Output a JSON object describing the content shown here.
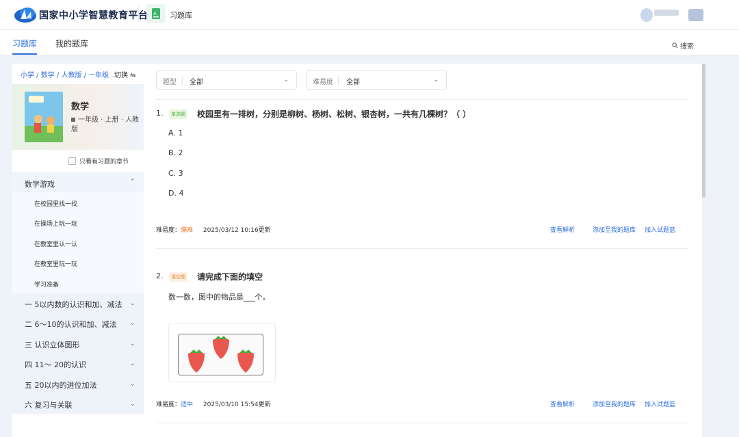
{
  "header": {
    "brand": "国家中小学智慧教育平台",
    "app_name": "习题库"
  },
  "tabs": [
    {
      "label": "习题库",
      "active": true
    },
    {
      "label": "我的题库",
      "active": false
    }
  ],
  "search": {
    "label": "搜索"
  },
  "sidebar": {
    "breadcrumb": "小学 / 数学 / 人教版 / 一年级 ...",
    "switch_label": "切换 ⇋",
    "book": {
      "cover_text": "数学",
      "title": "数学",
      "meta": "一年级 · 上册 · 人教版"
    },
    "only_with_questions": "只看有习题的章节",
    "open_chapter": "数学游戏",
    "sub_items": [
      "在校园里找一找",
      "在操场上玩一玩",
      "在教室里认一认",
      "在教室里玩一玩",
      "学习准备"
    ],
    "chapters": [
      "一  5以内数的认识和加、减法",
      "二  6～10的认识和加、减法",
      "三  认识立体图形",
      "四 11～ 20的认识",
      "五 20以内的进位加法",
      "六 复习与关联"
    ]
  },
  "filters": [
    {
      "key": "题型",
      "value": "全部"
    },
    {
      "key": "难易度",
      "value": "全部"
    }
  ],
  "questions": [
    {
      "num": "1.",
      "tag": "单选题",
      "title": "校园里有一排树，分别是柳树、杨树、松树、银杏树，一共有几棵树？（      ）",
      "options": [
        "A. 1",
        "B. 2",
        "C. 3",
        "D. 4"
      ],
      "difficulty_label": "难易度：",
      "difficulty": "偏难",
      "updated": "2025/03/12 10:16更新"
    },
    {
      "num": "2.",
      "tag": "填空题",
      "title": "请完成下面的填空",
      "body": "数一数，图中的物品是___个。",
      "difficulty_label": "难易度：",
      "difficulty": "适中",
      "updated": "2025/03/10 15:54更新"
    }
  ],
  "actions": {
    "view_analysis": "查看解析",
    "add_to_mine": "添加至我的题库",
    "add_to_basket": "加入试题篮"
  },
  "colors": {
    "accent": "#2f6fde",
    "hard": "#ef7c34",
    "page_bg": "#eef3fa"
  }
}
